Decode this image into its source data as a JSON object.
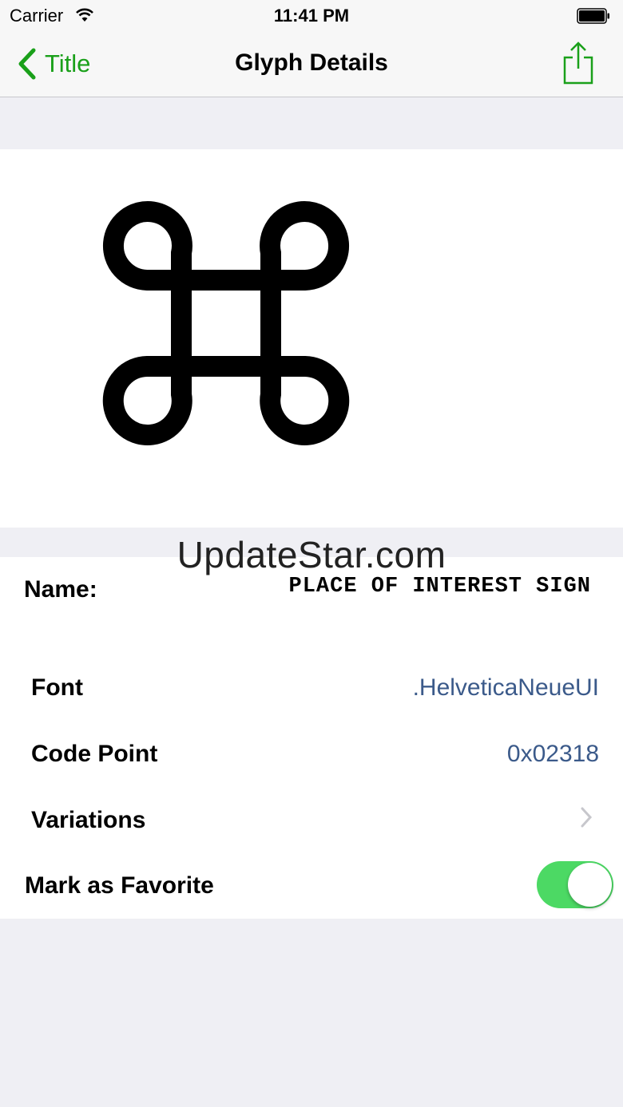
{
  "status_bar": {
    "carrier": "Carrier",
    "time": "11:41 PM"
  },
  "nav": {
    "back_label": "Title",
    "title": "Glyph Details"
  },
  "glyph": {
    "icon": "place-of-interest-sign"
  },
  "watermark": "UpdateStar.com",
  "details": {
    "name_label": "Name:",
    "name_value": "PLACE OF INTEREST SIGN",
    "rows": [
      {
        "label": "Font",
        "value": ".HelveticaNeueUI"
      },
      {
        "label": "Code Point",
        "value": "0x02318"
      },
      {
        "label": "Variations"
      }
    ],
    "favorite_label": "Mark as Favorite",
    "favorite_on": true
  },
  "colors": {
    "accent": "#1aa01a",
    "toggle_on": "#4cd964",
    "detail_value": "#3b5a8a",
    "background": "#efeff4"
  }
}
